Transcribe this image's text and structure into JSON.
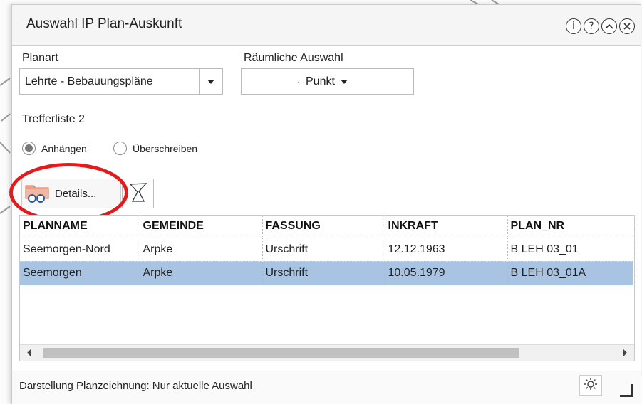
{
  "dialog": {
    "title": "Auswahl IP Plan-Auskunft",
    "icons": [
      "info-icon",
      "help-icon",
      "collapse-icon",
      "close-icon"
    ]
  },
  "planart": {
    "label": "Planart",
    "value": "Lehrte - Bebauungspläne"
  },
  "spatial": {
    "label": "Räumliche Auswahl",
    "value": "Punkt"
  },
  "results": {
    "label": "Trefferliste 2",
    "radio_append": "Anhängen",
    "radio_overwrite": "Überschreiben",
    "selected_mode": "append"
  },
  "toolbar": {
    "details_label": "Details..."
  },
  "table": {
    "columns": [
      "PLANNAME",
      "GEMEINDE",
      "FASSUNG",
      "INKRAFT",
      "PLAN_NR"
    ],
    "rows": [
      [
        "Seemorgen-Nord",
        "Arpke",
        "Urschrift",
        "12.12.1963",
        "B LEH 03_01"
      ],
      [
        "Seemorgen",
        "Arpke",
        "Urschrift",
        "10.05.1979",
        "B LEH 03_01A"
      ]
    ],
    "selected_row": 1
  },
  "footer": {
    "status": "Darstellung Planzeichnung: Nur aktuelle Auswahl"
  },
  "colors": {
    "selection": "#a9c4e2",
    "highlight": "#e21c1c"
  }
}
